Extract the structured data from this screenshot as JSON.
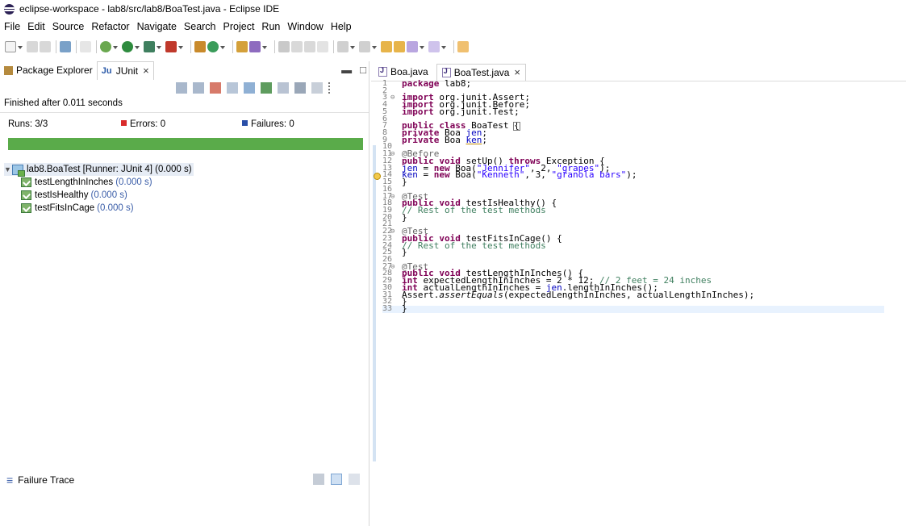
{
  "window": {
    "title": "eclipse-workspace - lab8/src/lab8/BoaTest.java - Eclipse IDE"
  },
  "menu": [
    "File",
    "Edit",
    "Source",
    "Refactor",
    "Navigate",
    "Search",
    "Project",
    "Run",
    "Window",
    "Help"
  ],
  "left": {
    "tabs": [
      {
        "label": "Package Explorer",
        "icon": "package-explorer-icon"
      },
      {
        "label": "JUnit",
        "icon": "junit-icon",
        "close": "×"
      }
    ],
    "finished": "Finished after 0.011 seconds",
    "runs_label": "Runs:",
    "runs_value": "3/3",
    "errors_label": "Errors:",
    "errors_value": "0",
    "failures_label": "Failures:",
    "failures_value": "0",
    "progress_color": "#5aab4a",
    "tree": {
      "root": {
        "label": "lab8.BoaTest [Runner: JUnit 4] (0.000 s)"
      },
      "children": [
        {
          "name": "testLengthInInches",
          "time": "(0.000 s)"
        },
        {
          "name": "testIsHealthy",
          "time": "(0.000 s)"
        },
        {
          "name": "testFitsInCage",
          "time": "(0.000 s)"
        }
      ]
    },
    "failure_trace": "Failure Trace"
  },
  "editor": {
    "tabs": [
      {
        "label": "Boa.java"
      },
      {
        "label": "BoaTest.java",
        "close": "×"
      }
    ],
    "line_numbers": [
      "1",
      "2",
      "3",
      "4",
      "5",
      "6",
      "7",
      "8",
      "9",
      "10",
      "11",
      "12",
      "13",
      "14",
      "15",
      "16",
      "17",
      "18",
      "19",
      "20",
      "21",
      "22",
      "23",
      "24",
      "25",
      "26",
      "27",
      "28",
      "29",
      "30",
      "31",
      "32",
      "33"
    ],
    "code": {
      "l1_kw": "package",
      "l1_rest": " lab8;",
      "l3_kw": "import",
      "l3_rest": " org.junit.Assert;",
      "l4_kw": "import",
      "l4_rest": " org.junit.Before;",
      "l5_kw": "import",
      "l5_rest": " org.junit.Test;",
      "l7_kw": "public class",
      "l7_rest": " BoaTest ",
      "l7_brace": "{",
      "l8_kw": "private",
      "l8_type": " Boa ",
      "l8_field": "jen",
      "l8_end": ";",
      "l9_kw": "private",
      "l9_type": " Boa ",
      "l9_field": "ken",
      "l9_end": ";",
      "l11_ann": "@Before",
      "l12_kw": "public void",
      "l12_mid": " setUp() ",
      "l12_kw2": "throws",
      "l12_end": " Exception {",
      "l13_field": "jen",
      "l13_a": " = ",
      "l13_kw": "new",
      "l13_b": " Boa(",
      "l13_s1": "\"Jennifer\"",
      "l13_c": ", 2, ",
      "l13_s2": "\"grapes\"",
      "l13_d": ");",
      "l14_field": "ken",
      "l14_a": " = ",
      "l14_kw": "new",
      "l14_b": " Boa(",
      "l14_s1": "\"Kenneth\"",
      "l14_c": ", 3, ",
      "l14_s2": "\"granola bars\"",
      "l14_d": ");",
      "l15": "}",
      "l17_ann": "@Test",
      "l18_kw": "public void",
      "l18_rest": " testIsHealthy() {",
      "l19_cm": "// Rest of the test methods",
      "l20": "}",
      "l22_ann": "@Test",
      "l23_kw": "public void",
      "l23_rest": " testFitsInCage() {",
      "l24_cm": "// Rest of the test methods",
      "l25": "}",
      "l27_ann": "@Test",
      "l28_kw": "public void",
      "l28_rest": " testLengthInInches() {",
      "l29_kw": "int",
      "l29_rest": " expectedLengthInInches = 2 * 12; ",
      "l29_cm": "// 2 feet = 24 inches",
      "l30_kw": "int",
      "l30_rest": " actualLengthInInches = ",
      "l30_field": "jen",
      "l30_end": ".lengthInInches();",
      "l31_a": "Assert.",
      "l31_it": "assertEquals",
      "l31_b": "(expectedLengthInInches, actualLengthInInches);",
      "l32": "}",
      "l33": "}"
    }
  }
}
